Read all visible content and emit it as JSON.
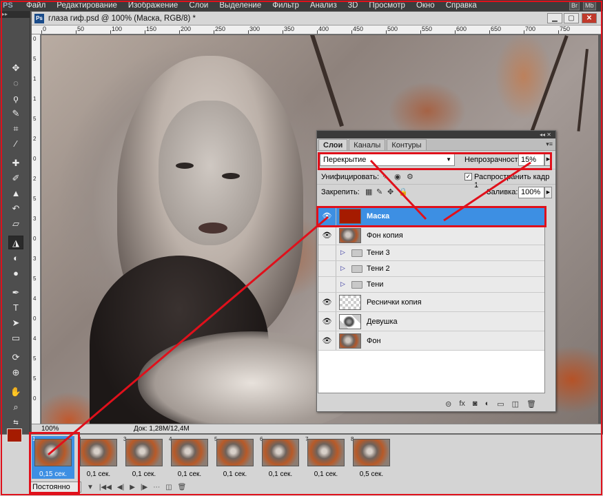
{
  "app": {
    "logo": "PS"
  },
  "menu": {
    "items": [
      "Файл",
      "Редактирование",
      "Изображение",
      "Слои",
      "Выделение",
      "Фильтр",
      "Анализ",
      "3D",
      "Просмотр",
      "Окно",
      "Справка"
    ],
    "mini_buttons": [
      "Br",
      "Mb"
    ]
  },
  "document": {
    "title": "глаза гиф.psd @ 100% (Маска, RGB/8) *",
    "badge": "Ps",
    "ruler_ticks": [
      "0",
      "50",
      "100",
      "150",
      "200",
      "250",
      "300",
      "350",
      "400",
      "450",
      "500",
      "550",
      "600",
      "650",
      "700",
      "750"
    ],
    "left_ticks": [
      "0",
      "5",
      "1",
      "1",
      "5",
      "2",
      "0",
      "2",
      "5",
      "3",
      "0",
      "3",
      "5",
      "4",
      "0",
      "4",
      "5",
      "5",
      "0"
    ]
  },
  "tools": [
    "move-icon",
    "marquee-icon",
    "lasso-icon",
    "quick-select-icon",
    "crop-icon",
    "eyedropper-icon",
    "healing-icon",
    "brush-icon",
    "stamp-icon",
    "history-brush-icon",
    "eraser-icon",
    "gradient-icon",
    "paint-bucket-icon",
    "blur-icon",
    "dodge-icon",
    "pen-icon",
    "type-icon",
    "path-select-icon",
    "shape-icon",
    "3d-rotate-icon",
    "3d-orbit-icon",
    "hand-icon",
    "zoom-icon"
  ],
  "colors": {
    "foreground": "#a51b00",
    "background": "#ffffff",
    "highlight": "#e0101b",
    "selection": "#3d8fe3"
  },
  "panel": {
    "tabs": [
      "Слои",
      "Каналы",
      "Контуры"
    ],
    "blend_mode": "Перекрытие",
    "opacity_label": "Непрозрачность:",
    "opacity_value": "15%",
    "unify_label": "Унифицировать:",
    "propagate_label": "Распространить кадр 1",
    "lock_label": "Закрепить:",
    "fill_label": "Заливка:",
    "fill_value": "100%",
    "layers": [
      {
        "name": "Маска",
        "visible": true,
        "selected": true,
        "type": "fill"
      },
      {
        "name": "Фон копия",
        "visible": true,
        "selected": false,
        "type": "photo"
      },
      {
        "name": "Тени 3",
        "visible": false,
        "selected": false,
        "type": "group"
      },
      {
        "name": "Тени 2",
        "visible": false,
        "selected": false,
        "type": "group"
      },
      {
        "name": "Тени",
        "visible": false,
        "selected": false,
        "type": "group"
      },
      {
        "name": "Реснички копия",
        "visible": true,
        "selected": false,
        "type": "transparent"
      },
      {
        "name": "Девушка",
        "visible": true,
        "selected": false,
        "type": "girl"
      },
      {
        "name": "Фон",
        "visible": true,
        "selected": false,
        "type": "photo"
      }
    ],
    "footer_icons": [
      "link-icon",
      "fx-icon",
      "mask-icon",
      "adjustment-icon",
      "group-icon",
      "new-layer-icon",
      "trash-icon"
    ],
    "footer_glyphs": [
      "⊝",
      "fx",
      "◙",
      "◐",
      "▭",
      "◫",
      "🗑"
    ]
  },
  "status": {
    "zoom": "100%",
    "doc_info": "Док: 1,28M/12,4M"
  },
  "animation": {
    "frames": [
      {
        "num": "1",
        "delay": "0,15 сек.",
        "selected": true
      },
      {
        "num": "2",
        "delay": "0,1 сек.",
        "selected": false
      },
      {
        "num": "3",
        "delay": "0,1 сек.",
        "selected": false
      },
      {
        "num": "4",
        "delay": "0,1 сек.",
        "selected": false
      },
      {
        "num": "5",
        "delay": "0,1 сек.",
        "selected": false
      },
      {
        "num": "6",
        "delay": "0,1 сек.",
        "selected": false
      },
      {
        "num": "7",
        "delay": "0,1 сек.",
        "selected": false
      },
      {
        "num": "8",
        "delay": "0,5 сек.",
        "selected": false
      }
    ],
    "loop": "Постоянно"
  }
}
